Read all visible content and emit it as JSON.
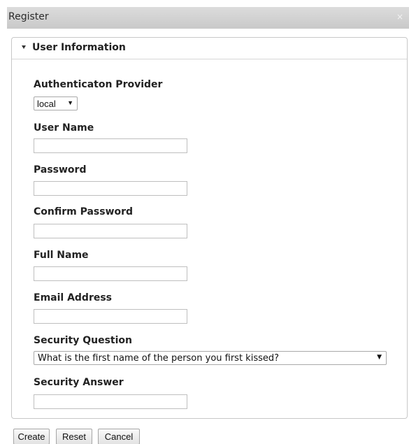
{
  "dialog": {
    "title": "Register",
    "close_glyph": "×"
  },
  "section": {
    "label": "User Information"
  },
  "fields": {
    "auth_provider_label": "Authenticaton Provider",
    "auth_provider_value": "local",
    "username_label": "User Name",
    "username_value": "",
    "password_label": "Password",
    "password_value": "",
    "confirm_password_label": "Confirm Password",
    "confirm_password_value": "",
    "full_name_label": "Full Name",
    "full_name_value": "",
    "email_label": "Email Address",
    "email_value": "",
    "security_question_label": "Security Question",
    "security_question_value": "What is the first name of the person you first kissed?",
    "security_answer_label": "Security Answer",
    "security_answer_value": ""
  },
  "buttons": {
    "create": "Create",
    "reset": "Reset",
    "cancel": "Cancel"
  },
  "icons": {
    "dropdown_arrow": "▼"
  }
}
